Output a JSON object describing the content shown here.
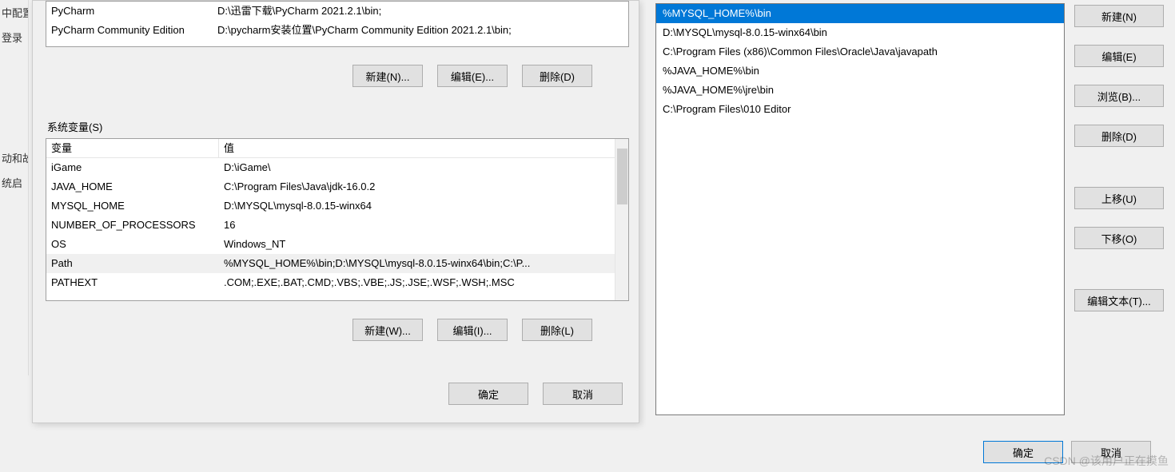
{
  "sidebar": {
    "items": [
      "中配置",
      "登录",
      "",
      "动和故",
      "统启"
    ]
  },
  "user_vars": {
    "rows": [
      {
        "name": "PyCharm",
        "value": "D:\\迅雷下载\\PyCharm 2021.2.1\\bin;"
      },
      {
        "name": "PyCharm Community Edition",
        "value": "D:\\pycharm安装位置\\PyCharm Community Edition 2021.2.1\\bin;"
      }
    ],
    "buttons": {
      "new": "新建(N)...",
      "edit": "编辑(E)...",
      "delete": "删除(D)"
    }
  },
  "sys_label": "系统变量(S)",
  "sys_vars": {
    "header": {
      "name": "变量",
      "value": "值"
    },
    "rows": [
      {
        "name": "iGame",
        "value": "D:\\iGame\\",
        "sel": false
      },
      {
        "name": "JAVA_HOME",
        "value": "C:\\Program Files\\Java\\jdk-16.0.2",
        "sel": false
      },
      {
        "name": "MYSQL_HOME",
        "value": "D:\\MYSQL\\mysql-8.0.15-winx64",
        "sel": false
      },
      {
        "name": "NUMBER_OF_PROCESSORS",
        "value": "16",
        "sel": false
      },
      {
        "name": "OS",
        "value": "Windows_NT",
        "sel": false
      },
      {
        "name": "Path",
        "value": "%MYSQL_HOME%\\bin;D:\\MYSQL\\mysql-8.0.15-winx64\\bin;C:\\P...",
        "sel": true
      },
      {
        "name": "PATHEXT",
        "value": ".COM;.EXE;.BAT;.CMD;.VBS;.VBE;.JS;.JSE;.WSF;.WSH;.MSC",
        "sel": false
      }
    ],
    "buttons": {
      "new": "新建(W)...",
      "edit": "编辑(I)...",
      "delete": "删除(L)"
    }
  },
  "env_footer": {
    "ok": "确定",
    "cancel": "取消"
  },
  "path_dialog": {
    "items": [
      {
        "text": "%MYSQL_HOME%\\bin",
        "selected": true
      },
      {
        "text": "D:\\MYSQL\\mysql-8.0.15-winx64\\bin",
        "selected": false
      },
      {
        "text": "C:\\Program Files (x86)\\Common Files\\Oracle\\Java\\javapath",
        "selected": false
      },
      {
        "text": "%JAVA_HOME%\\bin",
        "selected": false
      },
      {
        "text": "%JAVA_HOME%\\jre\\bin",
        "selected": false
      },
      {
        "text": "C:\\Program Files\\010 Editor",
        "selected": false
      }
    ],
    "buttons": {
      "new": "新建(N)",
      "edit": "编辑(E)",
      "browse": "浏览(B)...",
      "delete": "删除(D)",
      "up": "上移(U)",
      "down": "下移(O)",
      "edit_text": "编辑文本(T)..."
    },
    "footer": {
      "ok": "确定",
      "cancel": "取消"
    }
  },
  "watermark": "CSDN @该用户正在摸鱼"
}
